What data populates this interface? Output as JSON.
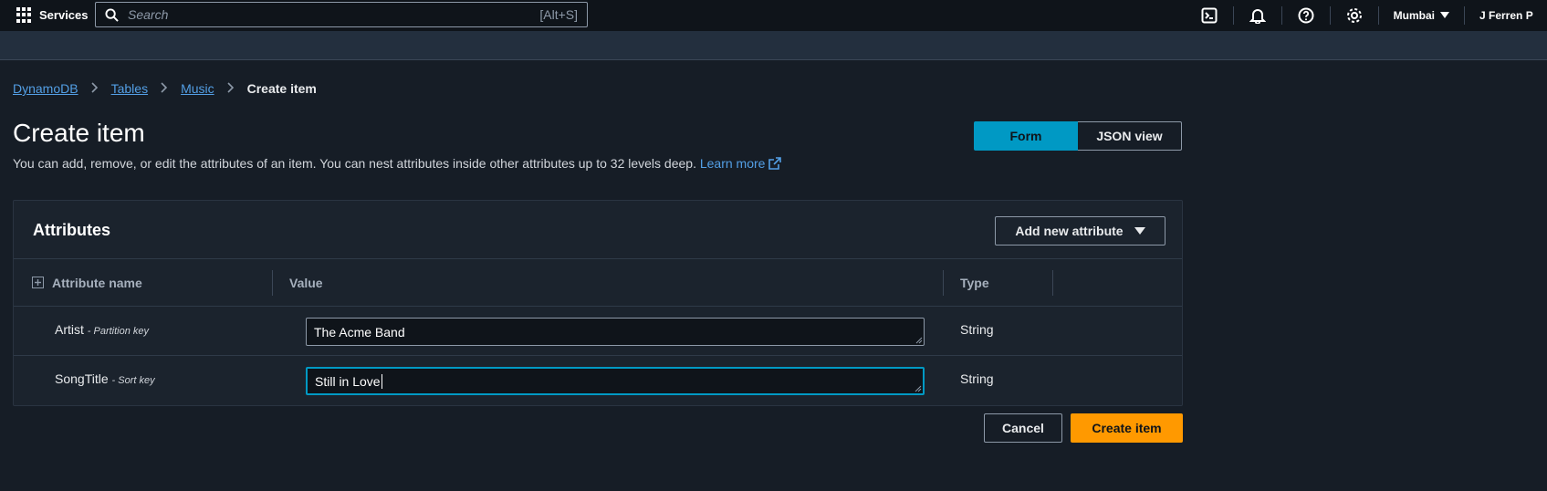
{
  "nav": {
    "services_label": "Services",
    "search_placeholder": "Search",
    "search_shortcut": "[Alt+S]",
    "region": "Mumbai",
    "user": "J Ferren P"
  },
  "breadcrumb": {
    "items": [
      "DynamoDB",
      "Tables",
      "Music"
    ],
    "current": "Create item"
  },
  "header": {
    "title": "Create item",
    "description": "You can add, remove, or edit the attributes of an item. You can nest attributes inside other attributes up to 32 levels deep.",
    "learn_more": "Learn more"
  },
  "view_toggle": {
    "form": "Form",
    "json": "JSON view",
    "selected": "Form"
  },
  "attributes": {
    "title": "Attributes",
    "add_button": "Add new attribute",
    "columns": [
      "Attribute name",
      "Value",
      "Type"
    ],
    "rows": [
      {
        "name": "Artist",
        "key_label": "- Partition key",
        "value": "The Acme Band",
        "type": "String"
      },
      {
        "name": "SongTitle",
        "key_label": "- Sort key",
        "value": "Still in Love",
        "type": "String"
      }
    ]
  },
  "actions": {
    "cancel": "Cancel",
    "create": "Create item"
  },
  "colors": {
    "accent": "#0099c4",
    "primary_button": "#ff9900",
    "link": "#539fe5",
    "background": "#161d26",
    "nav": "#232f3e"
  }
}
